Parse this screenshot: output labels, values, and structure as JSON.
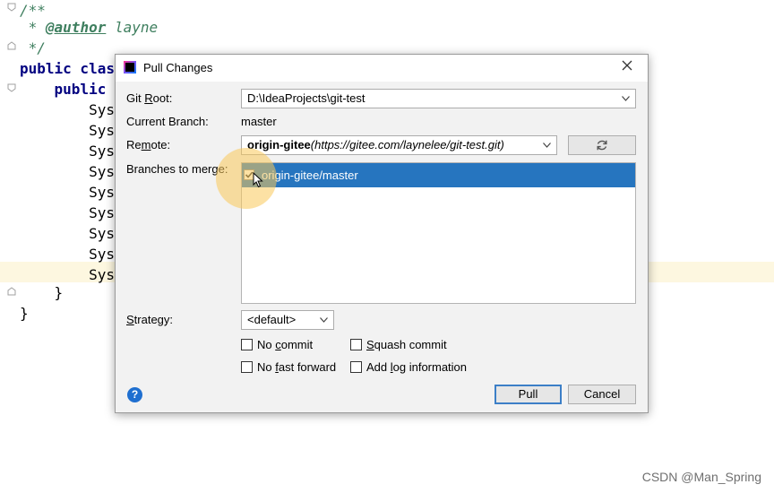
{
  "editor": {
    "lines": [
      {
        "parts": [
          {
            "cls": "cmt",
            "text": "/**"
          }
        ]
      },
      {
        "parts": [
          {
            "cls": "cmt",
            "text": " * "
          },
          {
            "cls": "tag",
            "text": "@author"
          },
          {
            "cls": "cmt",
            "text": " layne"
          }
        ]
      },
      {
        "parts": [
          {
            "cls": "cmt",
            "text": " */"
          }
        ]
      },
      {
        "parts": [
          {
            "cls": "kw",
            "text": "public clas"
          }
        ]
      },
      {
        "parts": [
          {
            "cls": "kw",
            "text": "    public "
          }
        ]
      },
      {
        "parts": [
          {
            "cls": "plain",
            "text": "        Sys"
          }
        ]
      },
      {
        "parts": [
          {
            "cls": "plain",
            "text": "        Sys"
          }
        ]
      },
      {
        "parts": [
          {
            "cls": "plain",
            "text": "        Sys"
          }
        ]
      },
      {
        "parts": [
          {
            "cls": "plain",
            "text": "        Sys"
          }
        ]
      },
      {
        "parts": [
          {
            "cls": "plain",
            "text": "        Sys"
          }
        ]
      },
      {
        "parts": [
          {
            "cls": "plain",
            "text": "        Sys"
          }
        ]
      },
      {
        "parts": [
          {
            "cls": "plain",
            "text": "        Sys"
          }
        ]
      },
      {
        "parts": [
          {
            "cls": "plain",
            "text": "        Sys"
          }
        ]
      },
      {
        "parts": [
          {
            "cls": "plain",
            "text": "        Sys"
          }
        ]
      },
      {
        "parts": [
          {
            "cls": "plain",
            "text": "    }"
          }
        ]
      },
      {
        "parts": [
          {
            "cls": "plain",
            "text": "}"
          }
        ]
      }
    ]
  },
  "watermark": "CSDN @Man_Spring",
  "dialog": {
    "title": "Pull Changes",
    "close_icon": "close-icon",
    "git_root": {
      "label_pre": "Git ",
      "label_u": "R",
      "label_post": "oot:",
      "value": "D:\\IdeaProjects\\git-test"
    },
    "current_branch": {
      "label": "Current Branch:",
      "value": "master"
    },
    "remote": {
      "label_pre": "Re",
      "label_u": "m",
      "label_post": "ote:",
      "name": "origin-gitee",
      "url": "(https://gitee.com/laynelee/git-test.git)"
    },
    "branches": {
      "label": "Branches to merge:",
      "items": [
        {
          "label": "origin-gitee/master",
          "checked": true,
          "selected": true
        }
      ]
    },
    "strategy": {
      "label_pre": "",
      "label_u": "S",
      "label_post": "trategy:",
      "value": "<default>"
    },
    "options": {
      "no_commit": {
        "pre": "No ",
        "u": "c",
        "post": "ommit"
      },
      "squash_commit": {
        "pre": "",
        "u": "S",
        "post": "quash commit"
      },
      "no_fast_forward": {
        "pre": "No ",
        "u": "f",
        "post": "ast forward"
      },
      "add_log": {
        "pre": "Add ",
        "u": "l",
        "post": "og information"
      }
    },
    "buttons": {
      "pull": "Pull",
      "cancel": "Cancel",
      "help": "?"
    }
  }
}
